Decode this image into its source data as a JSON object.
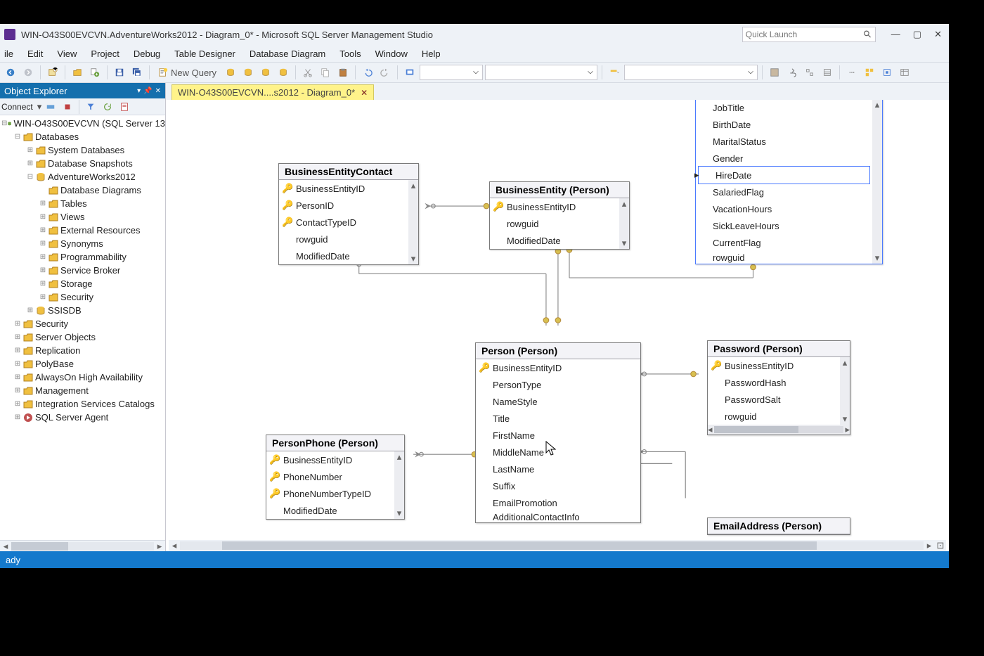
{
  "titlebar": {
    "title": "WIN-O43S00EVCVN.AdventureWorks2012 - Diagram_0* - Microsoft SQL Server Management Studio",
    "quick_launch_placeholder": "Quick Launch"
  },
  "menubar": [
    "ile",
    "Edit",
    "View",
    "Project",
    "Debug",
    "Table Designer",
    "Database Diagram",
    "Tools",
    "Window",
    "Help"
  ],
  "toolbar": {
    "new_query": "New Query"
  },
  "object_explorer": {
    "title": "Object Explorer",
    "connect_label": "Connect",
    "root": "WIN-O43S00EVCVN (SQL Server 13",
    "databases": "Databases",
    "children_db": [
      "System Databases",
      "Database Snapshots"
    ],
    "aw": "AdventureWorks2012",
    "aw_children": [
      "Database Diagrams",
      "Tables",
      "Views",
      "External Resources",
      "Synonyms",
      "Programmability",
      "Service Broker",
      "Storage",
      "Security"
    ],
    "ssisdb": "SSISDB",
    "siblings": [
      "Security",
      "Server Objects",
      "Replication",
      "PolyBase",
      "AlwaysOn High Availability",
      "Management",
      "Integration Services Catalogs",
      "SQL Server Agent"
    ]
  },
  "doc_tab": "WIN-O43S00EVCVN....s2012 - Diagram_0*",
  "entities": {
    "bec": {
      "title": "BusinessEntityContact",
      "cols": [
        {
          "pk": true,
          "name": "BusinessEntityID"
        },
        {
          "pk": true,
          "name": "PersonID"
        },
        {
          "pk": true,
          "name": "ContactTypeID"
        },
        {
          "pk": false,
          "name": "rowguid"
        },
        {
          "pk": false,
          "name": "ModifiedDate"
        }
      ]
    },
    "be": {
      "title": "BusinessEntity (Person)",
      "cols": [
        {
          "pk": true,
          "name": "BusinessEntityID"
        },
        {
          "pk": false,
          "name": "rowguid"
        },
        {
          "pk": false,
          "name": "ModifiedDate"
        }
      ]
    },
    "emp": {
      "cols": [
        "JobTitle",
        "BirthDate",
        "MaritalStatus",
        "Gender",
        "HireDate",
        "SalariedFlag",
        "VacationHours",
        "SickLeaveHours",
        "CurrentFlag",
        "rowguid"
      ],
      "selected": "HireDate"
    },
    "person": {
      "title": "Person (Person)",
      "cols": [
        {
          "pk": true,
          "name": "BusinessEntityID"
        },
        {
          "pk": false,
          "name": "PersonType"
        },
        {
          "pk": false,
          "name": "NameStyle"
        },
        {
          "pk": false,
          "name": "Title"
        },
        {
          "pk": false,
          "name": "FirstName"
        },
        {
          "pk": false,
          "name": "MiddleName"
        },
        {
          "pk": false,
          "name": "LastName"
        },
        {
          "pk": false,
          "name": "Suffix"
        },
        {
          "pk": false,
          "name": "EmailPromotion"
        },
        {
          "pk": false,
          "name": "AdditionalContactInfo"
        }
      ]
    },
    "phone": {
      "title": "PersonPhone (Person)",
      "cols": [
        {
          "pk": true,
          "name": "BusinessEntityID"
        },
        {
          "pk": true,
          "name": "PhoneNumber"
        },
        {
          "pk": true,
          "name": "PhoneNumberTypeID"
        },
        {
          "pk": false,
          "name": "ModifiedDate"
        }
      ]
    },
    "password": {
      "title": "Password (Person)",
      "cols": [
        {
          "pk": true,
          "name": "BusinessEntityID"
        },
        {
          "pk": false,
          "name": "PasswordHash"
        },
        {
          "pk": false,
          "name": "PasswordSalt"
        },
        {
          "pk": false,
          "name": "rowguid"
        }
      ]
    },
    "email": {
      "title": "EmailAddress (Person)"
    }
  },
  "status": "ady"
}
